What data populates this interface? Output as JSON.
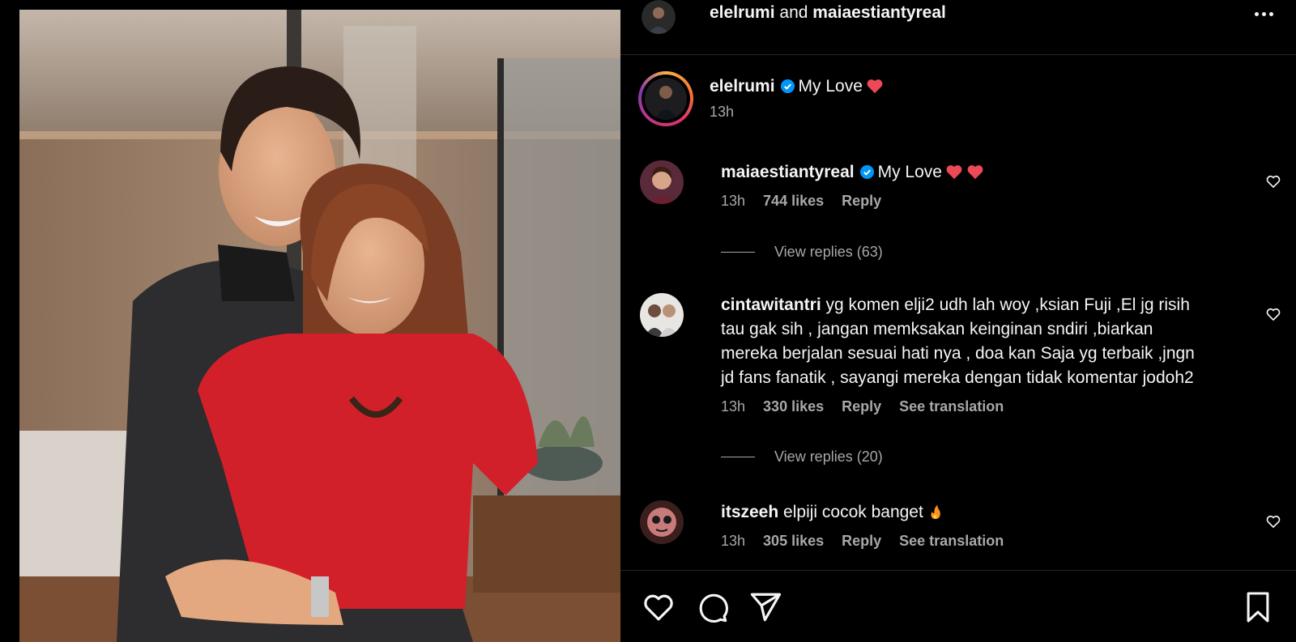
{
  "header": {
    "user1": "elelrumi",
    "conj": "and",
    "user2": "maiaestiantyreal",
    "more_icon": "more-horizontal-icon"
  },
  "caption": {
    "username": "elelrumi",
    "text": "My Love",
    "emoji": "red-heart",
    "time": "13h",
    "verified": true
  },
  "comments": [
    {
      "username": "maiaestiantyreal",
      "verified": true,
      "text": "My Love",
      "emojis": [
        "red-heart",
        "red-heart"
      ],
      "time": "13h",
      "likes": "744 likes",
      "reply": "Reply",
      "translation": "",
      "view_replies": "View replies (63)"
    },
    {
      "username": "cintawitantri",
      "verified": false,
      "text_lines": [
        "yg komen elji2 udh lah woy ,ksian Fuji ,El jg risih",
        "tau gak sih , jangan memksakan keinginan sndiri ,biarkan",
        "mereka berjalan sesuai hati nya , doa kan Saja yg terbaik ,jngn",
        "jd fans fanatik , sayangi mereka dengan tidak komentar jodoh2"
      ],
      "time": "13h",
      "likes": "330 likes",
      "reply": "Reply",
      "translation": "See translation",
      "view_replies": "View replies (20)"
    },
    {
      "username": "itszeeh",
      "verified": false,
      "text": "elpiji cocok banget",
      "emojis": [
        "fire"
      ],
      "time": "13h",
      "likes": "305 likes",
      "reply": "Reply",
      "translation": "See translation"
    }
  ],
  "actions": {
    "like": "heart-outline-icon",
    "comment": "comment-bubble-icon",
    "share": "paper-plane-icon",
    "save": "bookmark-icon"
  },
  "colors": {
    "background": "#000000",
    "text": "#f5f5f5",
    "muted": "#a8a8a8",
    "verified": "#0095f6",
    "heart": "#ed4956",
    "divider": "#262626"
  }
}
